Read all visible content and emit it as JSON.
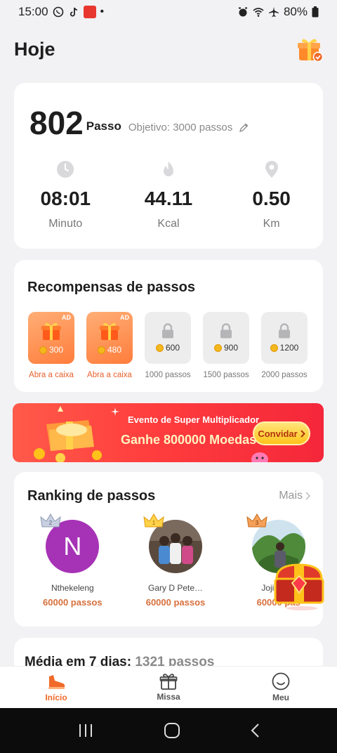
{
  "status": {
    "time": "15:00",
    "battery": "80%"
  },
  "header": {
    "title": "Hoje"
  },
  "steps": {
    "count": "802",
    "unit": "Passo",
    "goal": "Objetivo: 3000 passos",
    "metrics": [
      {
        "value": "08:01",
        "label": "Minuto",
        "icon": "clock-icon"
      },
      {
        "value": "44.11",
        "label": "Kcal",
        "icon": "flame-icon"
      },
      {
        "value": "0.50",
        "label": "Km",
        "icon": "location-pin-icon"
      }
    ]
  },
  "rewards": {
    "title": "Recompensas de passos",
    "items": [
      {
        "coins": "300",
        "label": "Abra a caixa",
        "state": "open",
        "badge": "AD"
      },
      {
        "coins": "480",
        "label": "Abra a caixa",
        "state": "open",
        "badge": "AD"
      },
      {
        "coins": "600",
        "label": "1000 passos",
        "state": "locked"
      },
      {
        "coins": "900",
        "label": "1500 passos",
        "state": "locked"
      },
      {
        "coins": "1200",
        "label": "2000 passos",
        "state": "locked"
      }
    ]
  },
  "banner": {
    "line1": "Evento de Super Multiplicador",
    "line2": "Ganhe 800000 Moedas",
    "button": "Convidar"
  },
  "ranking": {
    "title": "Ranking de passos",
    "more": "Mais",
    "users": [
      {
        "initial": "N",
        "name": "Nthekeleng",
        "steps": "60000 passos"
      },
      {
        "name": "Gary D Pete…",
        "steps": "60000 passos"
      },
      {
        "name": "Joji Delin",
        "steps": "60000 pas"
      }
    ]
  },
  "average": {
    "label": "Média em 7 dias:",
    "value": "1321 passos"
  },
  "nav": {
    "items": [
      {
        "label": "Início"
      },
      {
        "label": "Missa"
      },
      {
        "label": "Meu"
      }
    ]
  },
  "colors": {
    "accent": "#f06a2a",
    "reward_open": "#ff8a4a",
    "banner": "#ff3d3d"
  }
}
